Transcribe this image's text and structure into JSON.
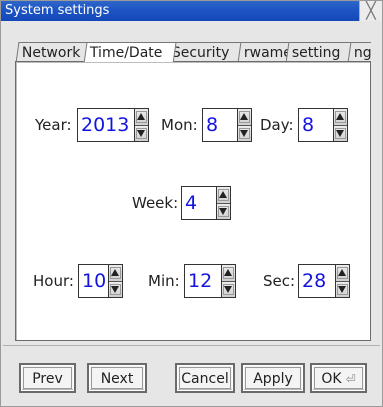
{
  "window": {
    "title": "System settings",
    "close_glyph": "╳"
  },
  "tabs": [
    {
      "label": "Network"
    },
    {
      "label": "Time/Date"
    },
    {
      "label": "Security"
    },
    {
      "label": "rwame"
    },
    {
      "label": "setting"
    },
    {
      "label": "ng"
    }
  ],
  "fields": {
    "year": {
      "label": "Year:",
      "value": "2013"
    },
    "month": {
      "label": "Mon:",
      "value": "8"
    },
    "day": {
      "label": "Day:",
      "value": "8"
    },
    "week": {
      "label": "Week:",
      "value": "4"
    },
    "hour": {
      "label": "Hour:",
      "value": "10"
    },
    "minute": {
      "label": "Min:",
      "value": "12"
    },
    "second": {
      "label": "Sec:",
      "value": "28"
    }
  },
  "buttons": {
    "prev": "Prev",
    "next": "Next",
    "cancel": "Cancel",
    "apply": "Apply",
    "ok": "OK",
    "ok_icon": "enter-key-icon"
  },
  "colors": {
    "titlebar": "#1d54c4",
    "value_text": "#1414e0"
  }
}
